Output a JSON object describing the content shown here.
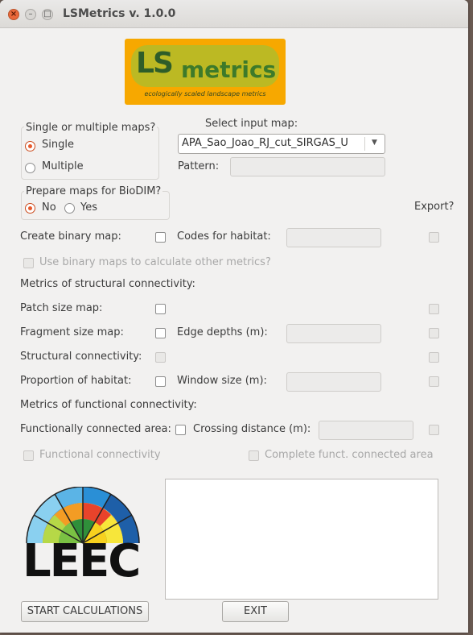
{
  "window": {
    "title": "LSMetrics v. 1.0.0"
  },
  "logo": {
    "ls": "LS",
    "metrics": "metrics",
    "subtitle": "ecologically scaled landscape metrics"
  },
  "map_mode": {
    "label": "Single or multiple maps?",
    "options": [
      "Single",
      "Multiple"
    ],
    "selected": "Single"
  },
  "input_map": {
    "label": "Select input map:",
    "value": "APA_Sao_Joao_RJ_cut_SIRGAS_U",
    "pattern_label": "Pattern:",
    "pattern_value": ""
  },
  "biodim": {
    "label": "Prepare maps for BioDIM?",
    "options": [
      "No",
      "Yes"
    ],
    "selected": "No"
  },
  "export_label": "Export?",
  "binary": {
    "label": "Create binary map:",
    "codes_label": "Codes for habitat:",
    "use_label": "Use binary maps to calculate other metrics?"
  },
  "structural": {
    "header": "Metrics of structural connectivity:",
    "patch_label": "Patch size map:",
    "fragment_label": "Fragment size map:",
    "edge_label": "Edge depths (m):",
    "connectivity_label": "Structural connectivity:",
    "proportion_label": "Proportion of habitat:",
    "window_label": "Window size (m):"
  },
  "functional": {
    "header": "Metrics of functional connectivity:",
    "area_label": "Functionally connected area:",
    "crossing_label": "Crossing distance (m):",
    "connectivity_label": "Functional connectivity",
    "complete_label": "Complete funct. connected area"
  },
  "leec": {
    "text": "LEEC"
  },
  "buttons": {
    "start": "START CALCULATIONS",
    "exit": "EXIT"
  },
  "colors": {
    "accent": "#e8592b",
    "logo_bg": "#f7a800"
  }
}
